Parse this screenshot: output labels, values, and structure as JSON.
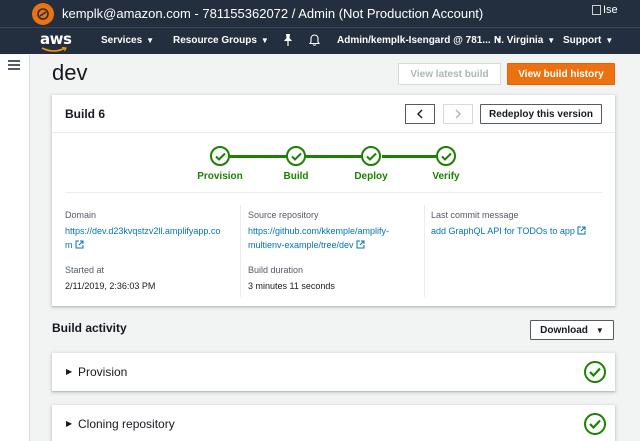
{
  "account_bar": {
    "account_text": "kemplk@amazon.com - 781155362072 / Admin (Not Production Account)",
    "broken_image_alt": "Ise"
  },
  "aws_nav": {
    "logo_text": "aws",
    "services": "Services",
    "resource_groups": "Resource Groups",
    "account_menu": "Admin/kemplk-Isengard @ 781...",
    "region": "N. Virginia",
    "support": "Support"
  },
  "header": {
    "title": "dev",
    "view_latest_build": "View latest build",
    "view_build_history": "View build history"
  },
  "build_card": {
    "title": "Build 6",
    "redeploy_label": "Redeploy this version",
    "steps": [
      {
        "label": "Provision",
        "status": "success"
      },
      {
        "label": "Build",
        "status": "success"
      },
      {
        "label": "Deploy",
        "status": "success"
      },
      {
        "label": "Verify",
        "status": "success"
      }
    ],
    "info": {
      "domain_label": "Domain",
      "domain_value_line1": "https://dev.d23kvqstzv2ll.amplifyapp.co",
      "domain_value_line2": "m",
      "source_repo_label": "Source repository",
      "source_repo_line1": "https://github.com/kkemple/amplify-",
      "source_repo_line2": "multienv-example/tree/dev",
      "last_commit_label": "Last commit message",
      "last_commit_value": "add GraphQL API for TODOs to app",
      "started_at_label": "Started at",
      "started_at_value": "2/11/2019, 2:36:03 PM",
      "build_duration_label": "Build duration",
      "build_duration_value": "3 minutes 11 seconds"
    }
  },
  "build_activity": {
    "title": "Build activity",
    "download_label": "Download",
    "rows": [
      {
        "label": "Provision",
        "status": "success"
      },
      {
        "label": "Cloning repository",
        "status": "success"
      }
    ]
  },
  "colors": {
    "nav_bg": "#232f3e",
    "accent_orange": "#ec7211",
    "success_green": "#1d8102",
    "link_blue": "#0073bb"
  }
}
